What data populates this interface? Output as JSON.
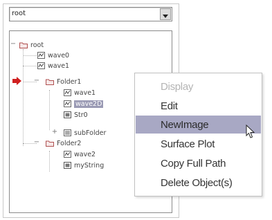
{
  "tree_panel": {
    "path_select": {
      "value": "root"
    },
    "nodes": [
      {
        "label": "root",
        "type": "folder",
        "expander": "−"
      },
      {
        "label": "wave0",
        "type": "wave"
      },
      {
        "label": "wave1",
        "type": "wave"
      },
      {
        "label": "Folder1",
        "type": "folder",
        "expander": "−"
      },
      {
        "label": "wave1",
        "type": "wave"
      },
      {
        "label": "wave2D",
        "type": "wave",
        "selected": true
      },
      {
        "label": "Str0",
        "type": "string"
      },
      {
        "label": "subFolder",
        "type": "data",
        "expander": "+"
      },
      {
        "label": "Folder2",
        "type": "folder",
        "expander": "−"
      },
      {
        "label": "wave2",
        "type": "wave"
      },
      {
        "label": "myString",
        "type": "string"
      }
    ]
  },
  "context_menu": {
    "items": [
      {
        "label": "Display",
        "state": "disabled"
      },
      {
        "label": "Edit",
        "state": "normal"
      },
      {
        "label": "NewImage",
        "state": "highlighted"
      },
      {
        "label": "Surface Plot",
        "state": "normal"
      },
      {
        "label": "Copy Full Path",
        "state": "normal"
      },
      {
        "label": "Delete Object(s)",
        "state": "normal"
      }
    ]
  },
  "colors": {
    "folder_icon": "#b05050",
    "selection_bg": "#9a9ab4",
    "menu_highlight": "#a8a8c4",
    "marker": "#d02020"
  }
}
